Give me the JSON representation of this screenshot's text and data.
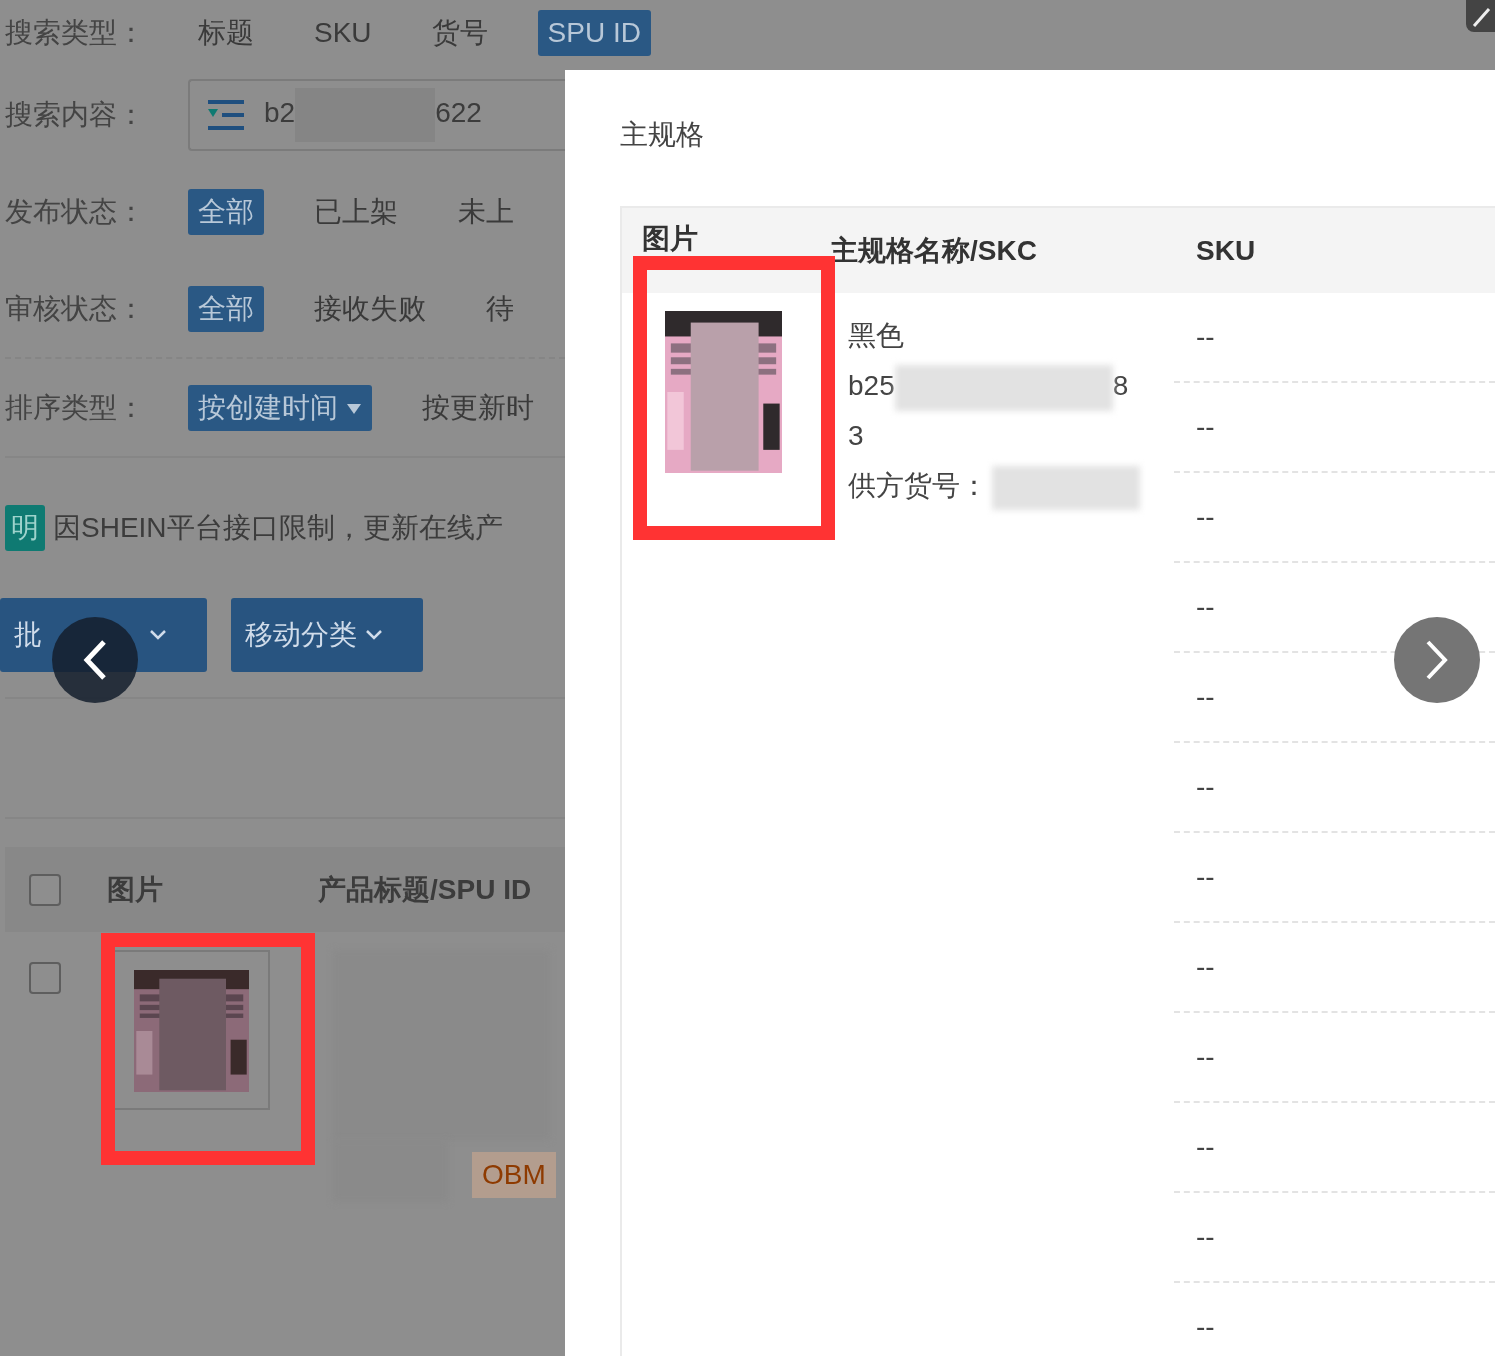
{
  "filters": [
    {
      "kind": "options",
      "label": "搜索类型：",
      "options": [
        {
          "label": "标题",
          "selected": false
        },
        {
          "label": "SKU",
          "selected": false
        },
        {
          "label": "货号",
          "selected": false
        },
        {
          "label": "SPU ID",
          "selected": true
        }
      ]
    },
    {
      "kind": "field",
      "label": "搜索内容：",
      "value_start": "b2",
      "value_end": "622"
    },
    {
      "kind": "options",
      "label": "发布状态：",
      "options": [
        {
          "label": "全部",
          "selected": true
        },
        {
          "label": "已上架",
          "selected": false
        },
        {
          "label": "未上",
          "selected": false
        }
      ]
    },
    {
      "kind": "options",
      "label": "审核状态：",
      "options": [
        {
          "label": "全部",
          "selected": true
        },
        {
          "label": "接收失败",
          "selected": false
        },
        {
          "label": "待",
          "selected": false
        }
      ]
    },
    {
      "kind": "options",
      "label": "排序类型：",
      "options": [
        {
          "label": "按创建时间",
          "selected": true
        },
        {
          "label": "按更新时",
          "selected": false
        }
      ]
    }
  ],
  "notice": {
    "badge": "明",
    "text": "因SHEIN平台接口限制，更新在线产"
  },
  "actions": [
    "批",
    "移动分类"
  ],
  "product_table": {
    "select_all_checked": false,
    "columns": [
      "图片",
      "产品标题/SPU ID"
    ],
    "rows": [
      {
        "checked": false,
        "tag": "OBM"
      }
    ]
  },
  "modal": {
    "title": "主规格",
    "columns": [
      "图片",
      "主规格名称/SKC",
      "SKU"
    ],
    "variant": {
      "lines": [
        {
          "text": "黑色"
        },
        {
          "text": "b25",
          "text_end": "8"
        },
        {
          "text": "3"
        },
        {
          "text": "供方货号："
        }
      ]
    },
    "sku_rows": [
      "--",
      "--",
      "--",
      "--",
      "--",
      "--",
      "--",
      "--",
      "--",
      "--",
      "--",
      "--"
    ]
  }
}
